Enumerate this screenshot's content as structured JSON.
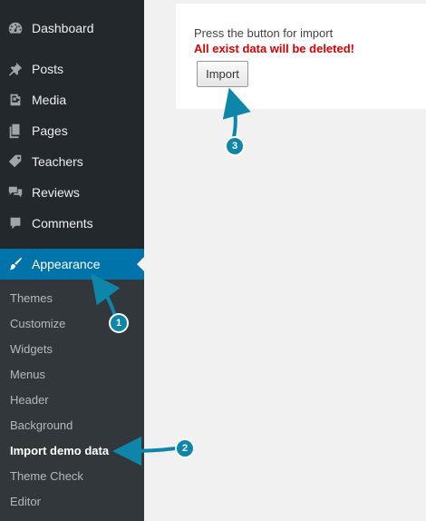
{
  "sidebar": {
    "items": [
      {
        "label": "Dashboard",
        "icon": "dashboard-icon"
      },
      {
        "label": "Posts",
        "icon": "pin-icon"
      },
      {
        "label": "Media",
        "icon": "media-icon"
      },
      {
        "label": "Pages",
        "icon": "pages-icon"
      },
      {
        "label": "Teachers",
        "icon": "tag-icon"
      },
      {
        "label": "Reviews",
        "icon": "reviews-icon"
      },
      {
        "label": "Comments",
        "icon": "comment-icon"
      },
      {
        "label": "Appearance",
        "icon": "brush-icon",
        "active": true
      }
    ],
    "submenu": [
      {
        "label": "Themes"
      },
      {
        "label": "Customize"
      },
      {
        "label": "Widgets"
      },
      {
        "label": "Menus"
      },
      {
        "label": "Header"
      },
      {
        "label": "Background"
      },
      {
        "label": "Import demo data",
        "current": true
      },
      {
        "label": "Theme Check"
      },
      {
        "label": "Editor"
      }
    ]
  },
  "content": {
    "note": "Press the button for import",
    "warning": "All exist data will be deleted!",
    "import_label": "Import"
  },
  "callouts": [
    {
      "number": "1"
    },
    {
      "number": "2"
    },
    {
      "number": "3"
    }
  ],
  "colors": {
    "sidebar_bg": "#23282d",
    "submenu_bg": "#32373c",
    "active": "#0073aa",
    "warning": "#dc0000",
    "callout": "#0e86aa"
  }
}
